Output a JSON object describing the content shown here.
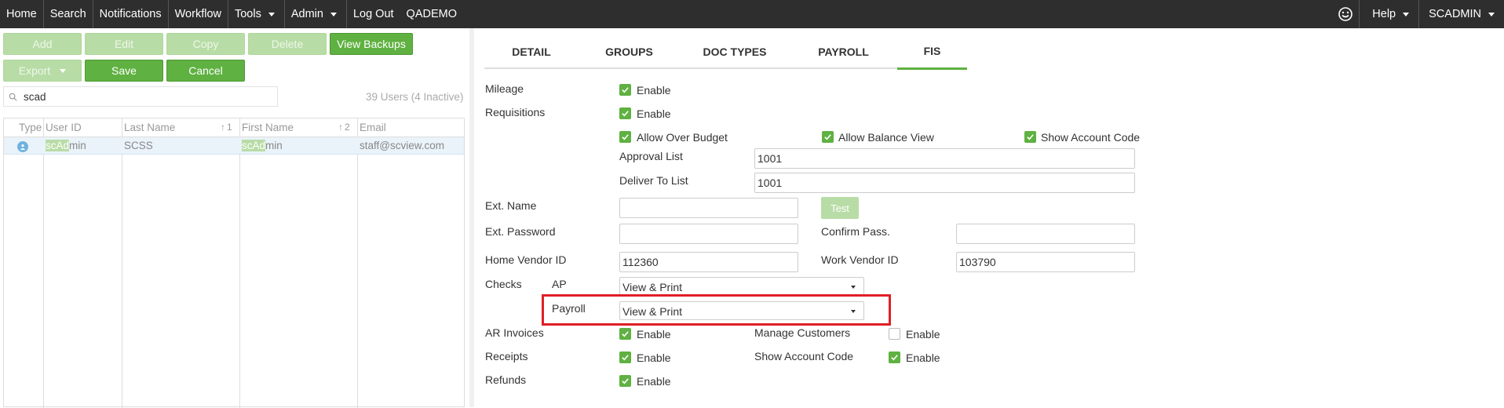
{
  "nav": {
    "home": "Home",
    "search": "Search",
    "notifications": "Notifications",
    "workflow": "Workflow",
    "tools": "Tools",
    "admin": "Admin",
    "logout": "Log Out",
    "org": "QADEMO",
    "help": "Help",
    "user": "SCADMIN"
  },
  "toolbar": {
    "add": "Add",
    "edit": "Edit",
    "copy": "Copy",
    "delete": "Delete",
    "view_backups": "View Backups",
    "export": "Export",
    "save": "Save",
    "cancel": "Cancel"
  },
  "search": {
    "value": "scad"
  },
  "users_count": "39 Users (4 Inactive)",
  "grid": {
    "headers": {
      "type": "Type",
      "user_id": "User ID",
      "last_name": "Last Name",
      "last_sort": "1",
      "first_name": "First Name",
      "first_sort": "2",
      "email": "Email"
    },
    "rows": [
      {
        "user_id_match": "scAd",
        "user_id_rest": "min",
        "last_name": "SCSS",
        "first_name_match": "scAd",
        "first_name_rest": "min",
        "email": "staff@scview.com"
      }
    ]
  },
  "tabs": [
    "DETAIL",
    "GROUPS",
    "DOC TYPES",
    "PAYROLL",
    "FIS"
  ],
  "active_tab": "FIS",
  "form": {
    "mileage": "Mileage",
    "requisitions": "Requisitions",
    "enable": "Enable",
    "allow_over_budget": "Allow Over Budget",
    "allow_balance_view": "Allow Balance View",
    "show_account_code": "Show Account Code",
    "approval_list": "Approval List",
    "approval_list_value": "1001",
    "deliver_to_list": "Deliver To List",
    "deliver_to_list_value": "1001",
    "ext_name": "Ext. Name",
    "ext_name_value": "",
    "test": "Test",
    "ext_password": "Ext. Password",
    "confirm_pass": "Confirm Pass.",
    "home_vendor_id": "Home Vendor ID",
    "home_vendor_id_value": "112360",
    "work_vendor_id": "Work Vendor ID",
    "work_vendor_id_value": "103790",
    "checks": "Checks",
    "ap": "AP",
    "ap_value": "View & Print",
    "payroll": "Payroll",
    "payroll_value": "View & Print",
    "ar_invoices": "AR Invoices",
    "manage_customers": "Manage Customers",
    "receipts": "Receipts",
    "show_account_code_2": "Show Account Code",
    "refunds": "Refunds"
  },
  "colors": {
    "accent": "#5fb141",
    "highlight": "#e01f26",
    "topbar": "#2e2e2e"
  }
}
